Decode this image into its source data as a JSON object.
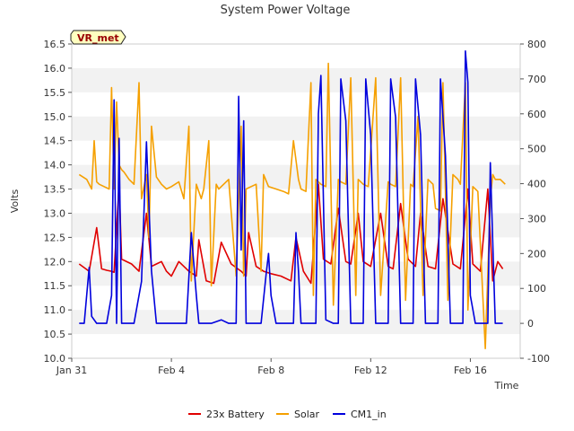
{
  "chart_data": {
    "type": "line",
    "title": "System Power Voltage",
    "xlabel": "Time",
    "ylabel": "Volts",
    "badge": "VR_met",
    "x_ticks": [
      "Jan 31",
      "Feb 4",
      "Feb 8",
      "Feb 12",
      "Feb 16"
    ],
    "x_unit": "days since Jan 31",
    "xlim": [
      0,
      18
    ],
    "ylim": [
      10.0,
      16.5
    ],
    "y2lim": [
      -100,
      800
    ],
    "y_ticks": [
      10.0,
      10.5,
      11.0,
      11.5,
      12.0,
      12.5,
      13.0,
      13.5,
      14.0,
      14.5,
      15.0,
      15.5,
      16.0,
      16.5
    ],
    "y2_ticks": [
      -100,
      0,
      100,
      200,
      300,
      400,
      500,
      600,
      700,
      800
    ],
    "grid_bands": true,
    "legend_position": "bottom",
    "series": [
      {
        "name": "23x Battery",
        "axis": "left",
        "color": "#e00000",
        "x": [
          0.3,
          0.7,
          1.0,
          1.2,
          1.4,
          1.6,
          1.7,
          1.9,
          2.0,
          2.4,
          2.7,
          3.0,
          3.2,
          3.4,
          3.6,
          3.8,
          4.0,
          4.3,
          4.7,
          5.0,
          5.1,
          5.4,
          5.7,
          6.0,
          6.4,
          6.8,
          7.0,
          7.1,
          7.4,
          7.7,
          8.0,
          8.4,
          8.8,
          9.0,
          9.3,
          9.6,
          9.9,
          10.1,
          10.4,
          10.7,
          11.0,
          11.2,
          11.5,
          11.7,
          12.0,
          12.4,
          12.7,
          12.9,
          13.2,
          13.5,
          13.8,
          14.0,
          14.3,
          14.6,
          14.9,
          15.3,
          15.6,
          15.9,
          16.1,
          16.4,
          16.7,
          16.9,
          17.1,
          17.3
        ],
        "y": [
          11.95,
          11.8,
          12.7,
          11.85,
          11.82,
          11.8,
          11.78,
          13.6,
          12.05,
          11.95,
          11.8,
          13.0,
          11.9,
          11.95,
          12.0,
          11.8,
          11.7,
          12.0,
          11.8,
          11.7,
          12.45,
          11.6,
          11.55,
          12.4,
          11.95,
          11.8,
          11.7,
          12.6,
          11.9,
          11.8,
          11.75,
          11.7,
          11.6,
          12.5,
          11.8,
          11.55,
          13.6,
          12.05,
          11.95,
          13.1,
          12.0,
          11.95,
          13.0,
          12.0,
          11.9,
          13.0,
          11.9,
          11.85,
          13.2,
          12.05,
          11.9,
          13.0,
          11.9,
          11.85,
          13.3,
          11.95,
          11.85,
          13.5,
          11.95,
          11.8,
          13.5,
          11.6,
          12.0,
          11.85
        ]
      },
      {
        "name": "Solar",
        "axis": "left",
        "color": "#f5a000",
        "x": [
          0.3,
          0.6,
          0.8,
          0.9,
          1.0,
          1.1,
          1.3,
          1.5,
          1.6,
          1.7,
          1.8,
          1.9,
          2.0,
          2.1,
          2.3,
          2.5,
          2.7,
          2.8,
          3.0,
          3.1,
          3.2,
          3.4,
          3.6,
          3.8,
          4.0,
          4.3,
          4.5,
          4.7,
          4.8,
          5.0,
          5.2,
          5.3,
          5.5,
          5.6,
          5.8,
          5.9,
          6.0,
          6.3,
          6.6,
          6.8,
          6.9,
          7.0,
          7.2,
          7.4,
          7.6,
          7.7,
          7.9,
          8.2,
          8.5,
          8.7,
          8.9,
          9.1,
          9.2,
          9.4,
          9.6,
          9.7,
          9.8,
          10.0,
          10.2,
          10.3,
          10.5,
          10.7,
          10.8,
          11.0,
          11.2,
          11.4,
          11.5,
          11.7,
          11.9,
          12.2,
          12.4,
          12.7,
          12.8,
          13.0,
          13.2,
          13.4,
          13.6,
          13.7,
          13.9,
          14.1,
          14.3,
          14.5,
          14.6,
          14.8,
          14.9,
          15.1,
          15.3,
          15.5,
          15.6,
          15.8,
          15.9,
          16.1,
          16.3,
          16.6,
          16.8,
          16.9,
          17.0,
          17.2,
          17.4
        ],
        "y": [
          13.8,
          13.7,
          13.5,
          14.5,
          13.65,
          13.6,
          13.55,
          13.5,
          15.6,
          13.5,
          15.3,
          14.0,
          13.9,
          13.85,
          13.7,
          13.6,
          15.7,
          13.3,
          13.8,
          12.5,
          14.8,
          13.75,
          13.6,
          13.5,
          13.55,
          13.65,
          13.3,
          14.8,
          11.6,
          13.6,
          13.3,
          13.5,
          14.5,
          11.5,
          13.6,
          13.5,
          13.55,
          13.7,
          11.7,
          14.8,
          11.7,
          13.5,
          13.55,
          13.6,
          11.8,
          13.8,
          13.55,
          13.5,
          13.45,
          13.4,
          14.5,
          13.7,
          13.5,
          13.45,
          15.7,
          11.3,
          13.7,
          13.6,
          13.55,
          16.1,
          11.1,
          13.7,
          13.65,
          13.6,
          15.8,
          11.3,
          13.7,
          13.6,
          13.55,
          15.8,
          11.3,
          13.65,
          13.6,
          13.55,
          15.8,
          11.2,
          13.6,
          13.55,
          15.0,
          11.3,
          13.7,
          13.6,
          13.1,
          13.05,
          15.7,
          11.2,
          13.8,
          13.7,
          13.6,
          15.7,
          11.0,
          13.55,
          13.45,
          10.2,
          13.3,
          13.8,
          13.7,
          13.7,
          13.6
        ]
      },
      {
        "name": "CM1_in",
        "axis": "right",
        "color": "#0000dd",
        "x": [
          0.3,
          0.5,
          0.7,
          0.8,
          1.0,
          1.2,
          1.4,
          1.6,
          1.7,
          1.8,
          1.9,
          2.0,
          2.1,
          2.3,
          2.5,
          2.8,
          3.0,
          3.2,
          3.4,
          3.6,
          4.0,
          4.3,
          4.6,
          4.8,
          5.0,
          5.1,
          5.3,
          5.6,
          6.0,
          6.3,
          6.6,
          6.7,
          6.8,
          6.9,
          7.0,
          7.3,
          7.6,
          7.8,
          7.9,
          8.0,
          8.2,
          8.5,
          8.9,
          9.0,
          9.1,
          9.2,
          9.5,
          9.8,
          9.9,
          10.0,
          10.2,
          10.5,
          10.7,
          10.8,
          11.0,
          11.2,
          11.5,
          11.7,
          11.8,
          12.0,
          12.2,
          12.5,
          12.7,
          12.8,
          13.0,
          13.2,
          13.5,
          13.7,
          13.8,
          14.0,
          14.2,
          14.5,
          14.7,
          14.8,
          15.0,
          15.2,
          15.5,
          15.7,
          15.8,
          15.9,
          16.0,
          16.2,
          16.5,
          16.7,
          16.8,
          17.0,
          17.3
        ],
        "y": [
          0,
          0,
          160,
          20,
          0,
          0,
          0,
          80,
          640,
          0,
          530,
          0,
          0,
          0,
          0,
          120,
          520,
          150,
          0,
          0,
          0,
          0,
          0,
          260,
          80,
          0,
          0,
          0,
          10,
          0,
          0,
          650,
          210,
          580,
          0,
          0,
          0,
          140,
          200,
          80,
          0,
          0,
          0,
          260,
          150,
          0,
          0,
          0,
          600,
          710,
          10,
          0,
          0,
          700,
          580,
          0,
          0,
          0,
          700,
          540,
          0,
          0,
          0,
          700,
          590,
          0,
          0,
          0,
          700,
          540,
          0,
          0,
          0,
          700,
          480,
          0,
          0,
          0,
          780,
          690,
          80,
          0,
          0,
          0,
          460,
          0,
          0
        ]
      }
    ]
  }
}
